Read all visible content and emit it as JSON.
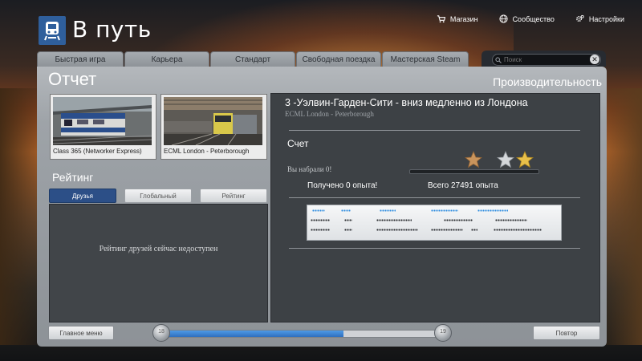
{
  "app": {
    "title": "В путь"
  },
  "topnav": [
    {
      "label": "Магазин",
      "icon": "cart-icon"
    },
    {
      "label": "Сообщество",
      "icon": "globe-icon"
    },
    {
      "label": "Настройки",
      "icon": "gear-icon"
    }
  ],
  "tabs": [
    {
      "label": "Быстрая игра"
    },
    {
      "label": "Карьера"
    },
    {
      "label": "Стандарт"
    },
    {
      "label": "Свободная поездка"
    },
    {
      "label": "Мастерская Steam"
    }
  ],
  "search": {
    "placeholder": "Поиск"
  },
  "page": {
    "title": "Отчет",
    "subtitle": "Производительность"
  },
  "thumbnails": [
    {
      "caption": "Class 365 (Networker Express)"
    },
    {
      "caption": "ECML London - Peterborough"
    }
  ],
  "rating": {
    "title": "Рейтинг",
    "tabs": [
      {
        "label": "Друзья",
        "active": true
      },
      {
        "label": "Глобальный",
        "active": false
      },
      {
        "label": "Рейтинг",
        "active": false
      }
    ],
    "message": "Рейтинг друзей сейчас недоступен"
  },
  "report": {
    "route_title": "3 -Уэлвин-Гарден-Сити - вниз медленно из Лондона",
    "route_subtitle": "ECML London - Peterborough",
    "score_title": "Счет",
    "scored_text": "Вы набрали 0!",
    "xp_gained": "Получено 0 опыта!",
    "xp_total": "Всего 27491 опыта",
    "progress": 0.0,
    "stars": [
      {
        "type": "bronze"
      },
      {
        "type": "silver"
      },
      {
        "type": "gold"
      }
    ]
  },
  "footer": {
    "main_menu": "Главное меню",
    "retry": "Повтор",
    "level_left": "18",
    "level_right": "19",
    "level_progress": 0.65
  },
  "colors": {
    "accent": "#2f6fbf",
    "panel": "#3d4145",
    "active_tab": "#2c4f87"
  }
}
